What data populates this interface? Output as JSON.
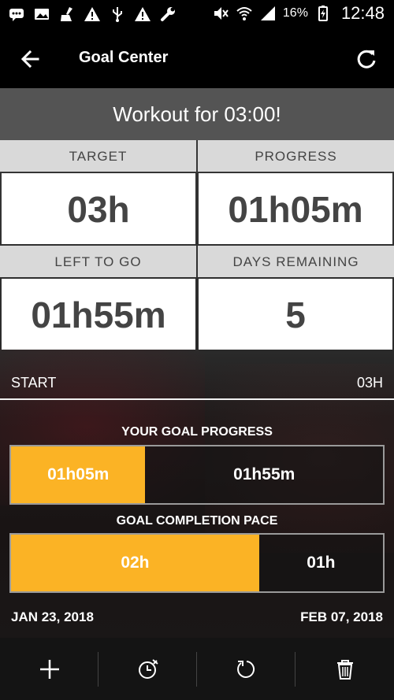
{
  "status_bar": {
    "battery_percent": "16%",
    "time": "12:48",
    "icons": [
      "message-icon",
      "photo-icon",
      "cleaner-icon",
      "warning-icon",
      "usb-icon",
      "warning-icon",
      "wrench-icon",
      "mute-icon",
      "wifi-icon",
      "signal-icon",
      "battery-icon"
    ]
  },
  "app_bar": {
    "title": "Goal Center",
    "back_icon": "arrow-left-icon",
    "refresh_icon": "refresh-icon"
  },
  "goal": {
    "title": "Workout for 03:00!",
    "target_label": "TARGET",
    "target_value": "03h",
    "progress_label": "PROGRESS",
    "progress_value": "01h05m",
    "left_label": "LEFT TO GO",
    "left_value": "01h55m",
    "days_label": "DAYS REMAINING",
    "days_value": "5"
  },
  "range": {
    "start": "START",
    "end": "03H"
  },
  "goal_progress": {
    "title": "YOUR GOAL PROGRESS",
    "done_label": "01h05m",
    "left_label": "01h55m",
    "fraction": 0.361
  },
  "completion_pace": {
    "title": "GOAL COMPLETION PACE",
    "done_label": "02h",
    "left_label": "01h",
    "fraction": 0.667
  },
  "dates": {
    "start": "JAN 23, 2018",
    "end": "FEB 07, 2018"
  },
  "toolbar": {
    "icons": [
      "plus-icon",
      "alarm-clock-icon",
      "reset-icon",
      "trash-icon"
    ]
  },
  "colors": {
    "accent": "#fbb325",
    "header_bg": "#000000",
    "title_strip": "#545454",
    "label_bg": "#d9d9d9",
    "value_text": "#444444"
  }
}
